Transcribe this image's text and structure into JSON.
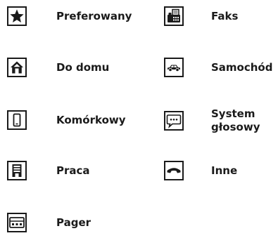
{
  "legend": {
    "items": [
      {
        "id": "preferred",
        "icon": "star-icon",
        "label": "Preferowany"
      },
      {
        "id": "home",
        "icon": "house-icon",
        "label": "Do domu"
      },
      {
        "id": "mobile",
        "icon": "mobile-phone-icon",
        "label": "Komórkowy"
      },
      {
        "id": "work",
        "icon": "office-building-icon",
        "label": "Praca"
      },
      {
        "id": "pager",
        "icon": "pager-icon",
        "label": "Pager"
      },
      {
        "id": "fax",
        "icon": "fax-icon",
        "label": "Faks"
      },
      {
        "id": "car",
        "icon": "car-icon",
        "label": "Samochód"
      },
      {
        "id": "voice",
        "icon": "voice-system-speech-bubble-icon",
        "label": "System głosowy"
      },
      {
        "id": "other",
        "icon": "phone-handset-icon",
        "label": "Inne"
      }
    ]
  }
}
